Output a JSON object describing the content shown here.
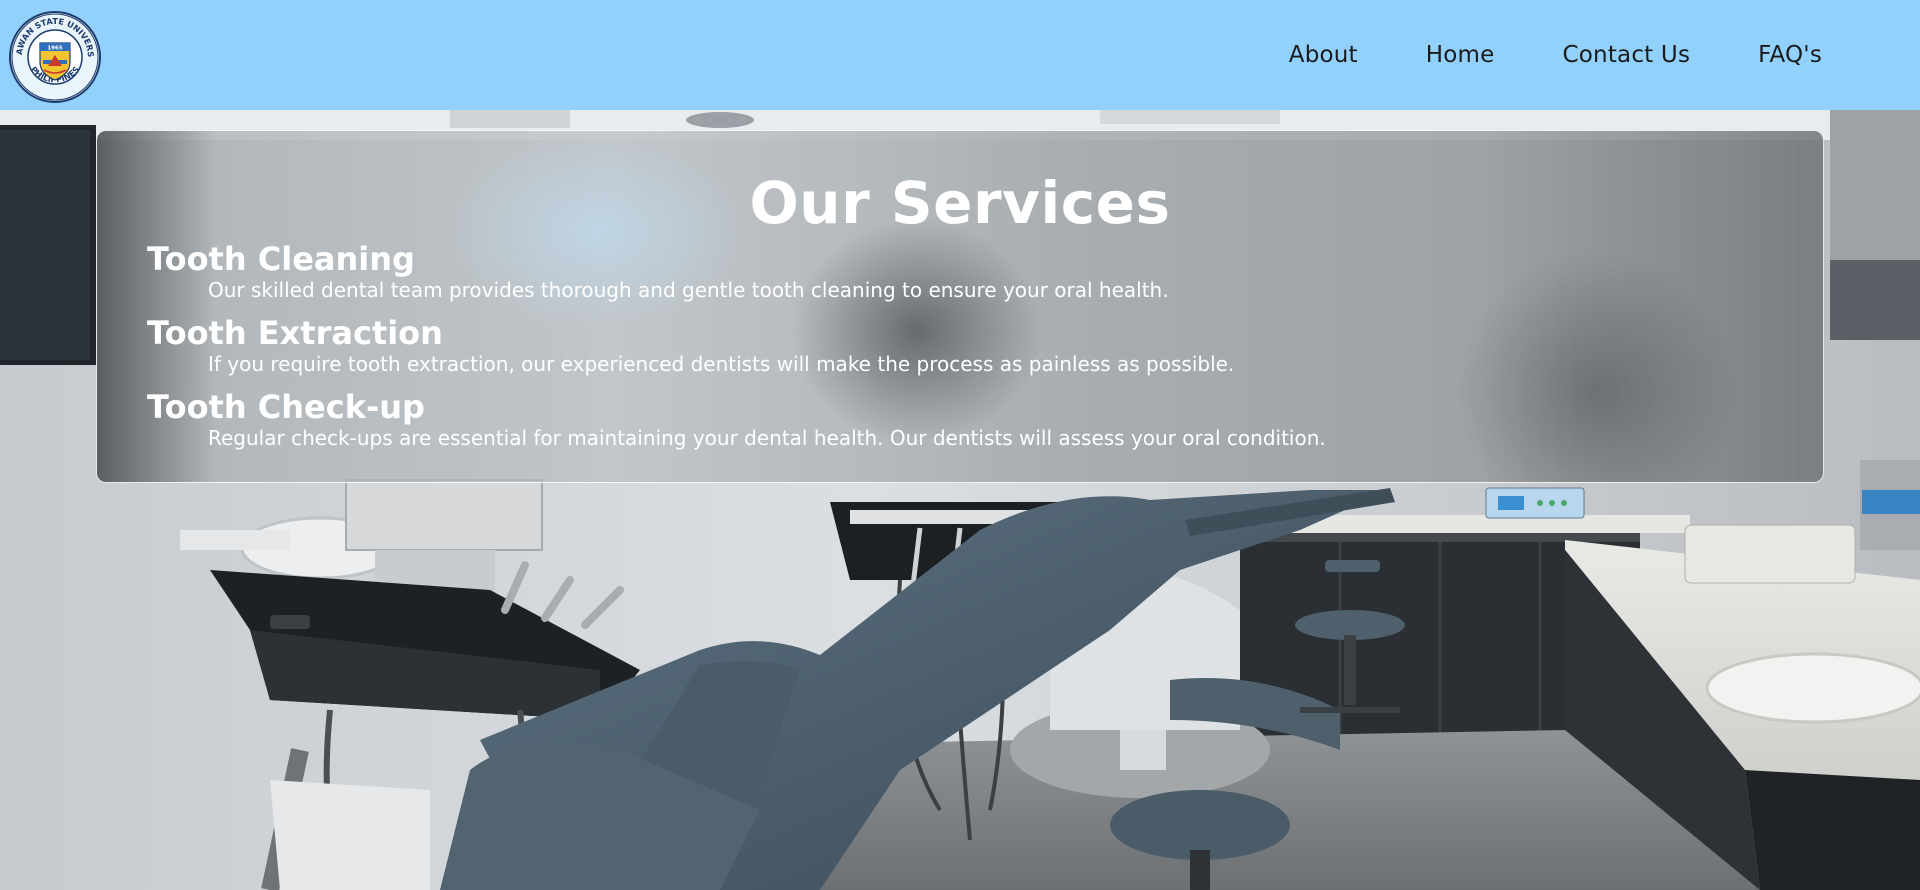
{
  "header": {
    "logo_alt": "Palawan State University seal",
    "logo_text_top": "PALAWAN STATE UNIVERSITY",
    "logo_text_bottom": "PHILIPPINES",
    "logo_year": "1965",
    "nav": [
      {
        "label": "About"
      },
      {
        "label": "Home"
      },
      {
        "label": "Contact Us"
      },
      {
        "label": "FAQ's"
      }
    ]
  },
  "services": {
    "title": "Our Services",
    "items": [
      {
        "title": "Tooth Cleaning",
        "description": "Our skilled dental team provides thorough and gentle tooth cleaning to ensure your oral health."
      },
      {
        "title": "Tooth Extraction",
        "description": "If you require tooth extraction, our experienced dentists will make the process as painless as possible."
      },
      {
        "title": "Tooth Check-up",
        "description": "Regular check-ups are essential for maintaining your dental health. Our dentists will assess your oral condition."
      }
    ]
  },
  "colors": {
    "navbar_bg": "#92d1fc",
    "nav_text": "#1b1b1b",
    "panel_border": "#ffffff",
    "text_light": "#ffffff"
  },
  "icons": {
    "logo": "university-seal-icon"
  }
}
